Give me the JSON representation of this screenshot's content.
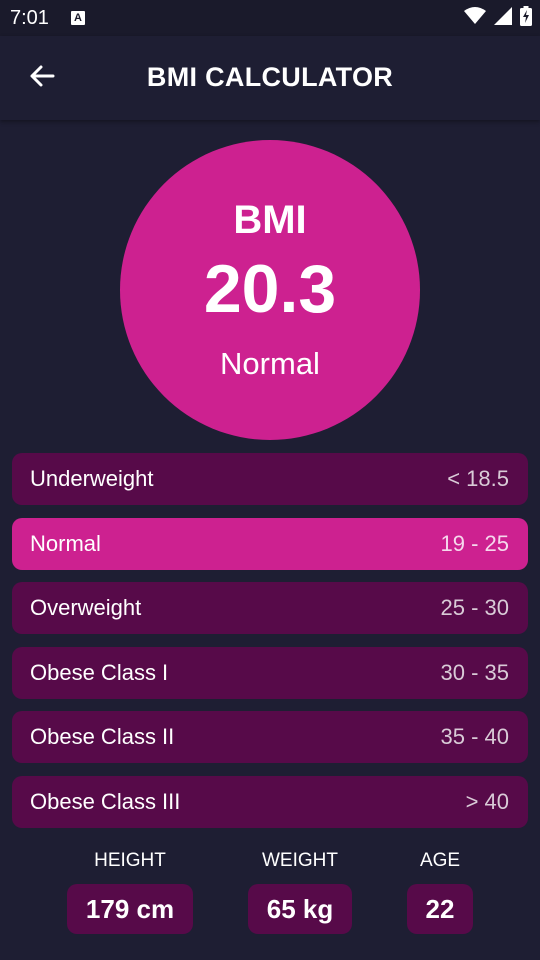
{
  "status_bar": {
    "time": "7:01",
    "notification_glyph": "A",
    "icons": [
      "wifi-icon",
      "signal-icon",
      "battery-charging-icon"
    ]
  },
  "app_bar": {
    "title": "BMI CALCULATOR",
    "back_icon": "arrow-left-icon"
  },
  "result": {
    "label": "BMI",
    "value": "20.3",
    "status": "Normal"
  },
  "ranges": [
    {
      "name": "Underweight",
      "value": "< 18.5",
      "active": false
    },
    {
      "name": "Normal",
      "value": "19 - 25",
      "active": true
    },
    {
      "name": "Overweight",
      "value": "25 - 30",
      "active": false
    },
    {
      "name": "Obese Class I",
      "value": "30 - 35",
      "active": false
    },
    {
      "name": "Obese Class II",
      "value": "35 - 40",
      "active": false
    },
    {
      "name": "Obese Class III",
      "value": "> 40",
      "active": false
    }
  ],
  "stats": {
    "height": {
      "label": "HEIGHT",
      "value": "179 cm"
    },
    "weight": {
      "label": "WEIGHT",
      "value": "65 kg"
    },
    "age": {
      "label": "AGE",
      "value": "22"
    }
  },
  "colors": {
    "background": "#1e1e33",
    "accent": "#cd2190",
    "row_background": "#570a49"
  }
}
